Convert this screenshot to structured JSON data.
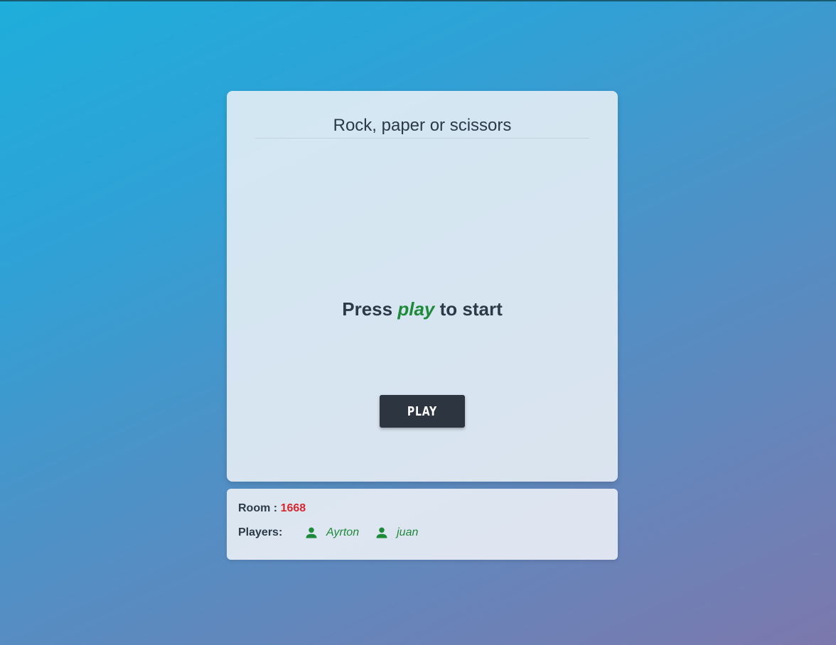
{
  "game": {
    "title": "Rock, paper or scissors",
    "prompt_prefix": "Press",
    "prompt_accent": "play",
    "prompt_suffix": "to start",
    "play_button_label": "PLAY"
  },
  "info": {
    "room_label": "Room :",
    "room_number": "1668",
    "players_label": "Players:",
    "players": [
      {
        "name": "Ayrton",
        "icon": "person-icon"
      },
      {
        "name": "juan",
        "icon": "person-icon"
      }
    ]
  },
  "colors": {
    "accent_green": "#1d8a3a",
    "room_red": "#d7262e",
    "button_dark": "#2d3540",
    "text_dark": "#2c3a48"
  }
}
